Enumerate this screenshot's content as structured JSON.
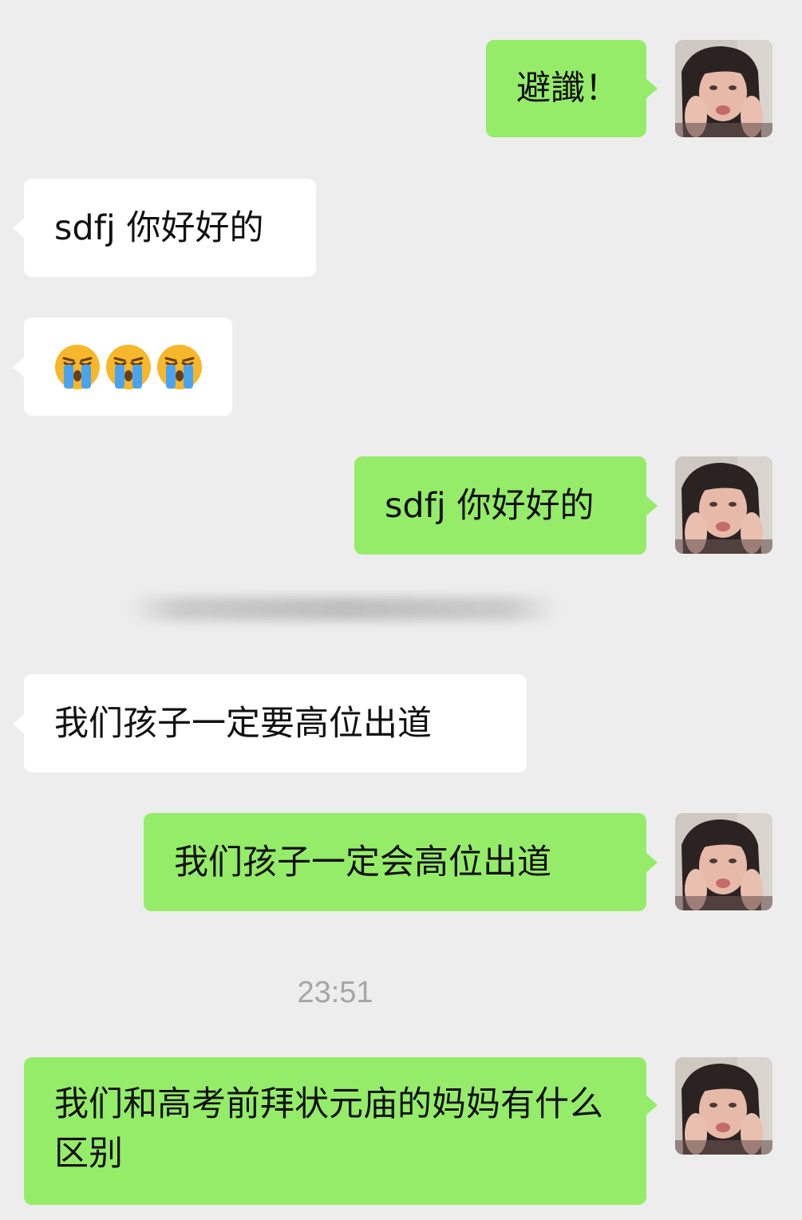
{
  "messages": [
    {
      "side": "outgoing",
      "text": "避讖！"
    },
    {
      "side": "incoming",
      "text": "sdfj 你好好的"
    },
    {
      "side": "incoming",
      "emoji": [
        "loudly-crying-face",
        "loudly-crying-face",
        "loudly-crying-face"
      ]
    },
    {
      "side": "outgoing",
      "text": "sdfj 你好好的"
    },
    {
      "side": "incoming",
      "text": "我们孩子一定要高位出道"
    },
    {
      "side": "outgoing",
      "text": "我们孩子一定会高位出道"
    },
    {
      "side": "outgoing",
      "text": "我们和高考前拜状元庙的妈妈有什么区别"
    }
  ],
  "timestamp": "23:51",
  "colors": {
    "background": "#ededed",
    "outgoing_bubble": "#95ec69",
    "incoming_bubble": "#ffffff",
    "timestamp_text": "#a5a5a5"
  },
  "icons": {
    "avatar": "user-avatar-photo",
    "emoji": "loudly-crying-face"
  }
}
